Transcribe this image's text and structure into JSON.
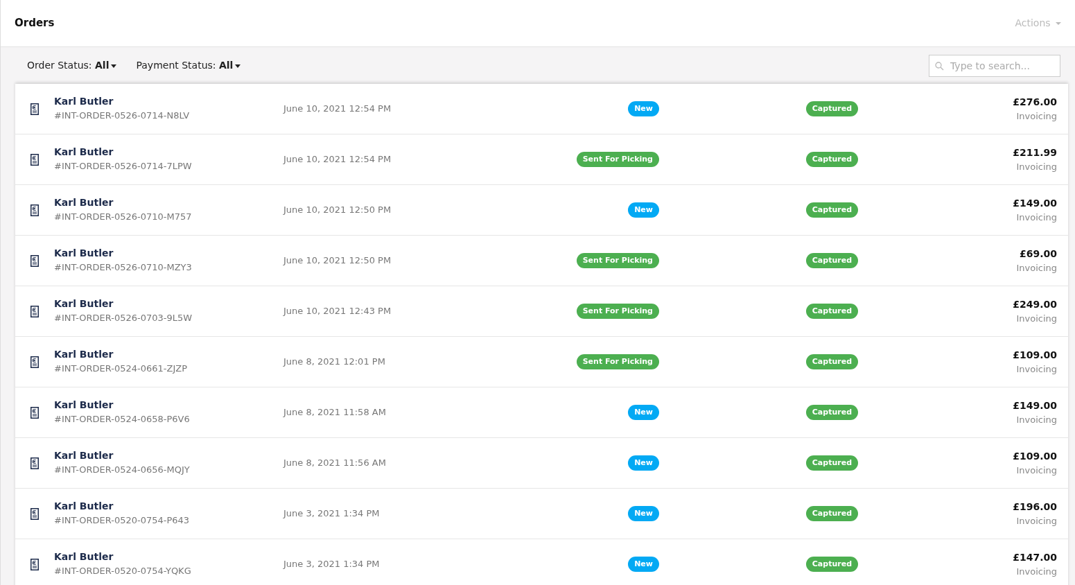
{
  "header": {
    "title": "Orders",
    "actions": "Actions"
  },
  "filters": [
    {
      "label": "Order Status:",
      "value": "All"
    },
    {
      "label": "Payment Status:",
      "value": "All"
    }
  ],
  "search": {
    "placeholder": "Type to search..."
  },
  "orders": [
    {
      "customer": "Karl Butler",
      "number": "#INT-ORDER-0526-0714-N8LV",
      "date": "June 10, 2021 12:54 PM",
      "order_status": {
        "text": "New",
        "color": "#03a9f4"
      },
      "payment_status": {
        "text": "Captured",
        "color": "#4caf50"
      },
      "amount": "£276.00",
      "stage": "Invoicing"
    },
    {
      "customer": "Karl Butler",
      "number": "#INT-ORDER-0526-0714-7LPW",
      "date": "June 10, 2021 12:54 PM",
      "order_status": {
        "text": "Sent For Picking",
        "color": "#4caf50"
      },
      "payment_status": {
        "text": "Captured",
        "color": "#4caf50"
      },
      "amount": "£211.99",
      "stage": "Invoicing"
    },
    {
      "customer": "Karl Butler",
      "number": "#INT-ORDER-0526-0710-M757",
      "date": "June 10, 2021 12:50 PM",
      "order_status": {
        "text": "New",
        "color": "#03a9f4"
      },
      "payment_status": {
        "text": "Captured",
        "color": "#4caf50"
      },
      "amount": "£149.00",
      "stage": "Invoicing"
    },
    {
      "customer": "Karl Butler",
      "number": "#INT-ORDER-0526-0710-MZY3",
      "date": "June 10, 2021 12:50 PM",
      "order_status": {
        "text": "Sent For Picking",
        "color": "#4caf50"
      },
      "payment_status": {
        "text": "Captured",
        "color": "#4caf50"
      },
      "amount": "£69.00",
      "stage": "Invoicing"
    },
    {
      "customer": "Karl Butler",
      "number": "#INT-ORDER-0526-0703-9L5W",
      "date": "June 10, 2021 12:43 PM",
      "order_status": {
        "text": "Sent For Picking",
        "color": "#4caf50"
      },
      "payment_status": {
        "text": "Captured",
        "color": "#4caf50"
      },
      "amount": "£249.00",
      "stage": "Invoicing"
    },
    {
      "customer": "Karl Butler",
      "number": "#INT-ORDER-0524-0661-ZJZP",
      "date": "June 8, 2021 12:01 PM",
      "order_status": {
        "text": "Sent For Picking",
        "color": "#4caf50"
      },
      "payment_status": {
        "text": "Captured",
        "color": "#4caf50"
      },
      "amount": "£109.00",
      "stage": "Invoicing"
    },
    {
      "customer": "Karl Butler",
      "number": "#INT-ORDER-0524-0658-P6V6",
      "date": "June 8, 2021 11:58 AM",
      "order_status": {
        "text": "New",
        "color": "#03a9f4"
      },
      "payment_status": {
        "text": "Captured",
        "color": "#4caf50"
      },
      "amount": "£149.00",
      "stage": "Invoicing"
    },
    {
      "customer": "Karl Butler",
      "number": "#INT-ORDER-0524-0656-MQJY",
      "date": "June 8, 2021 11:56 AM",
      "order_status": {
        "text": "New",
        "color": "#03a9f4"
      },
      "payment_status": {
        "text": "Captured",
        "color": "#4caf50"
      },
      "amount": "£109.00",
      "stage": "Invoicing"
    },
    {
      "customer": "Karl Butler",
      "number": "#INT-ORDER-0520-0754-P643",
      "date": "June 3, 2021 1:34 PM",
      "order_status": {
        "text": "New",
        "color": "#03a9f4"
      },
      "payment_status": {
        "text": "Captured",
        "color": "#4caf50"
      },
      "amount": "£196.00",
      "stage": "Invoicing"
    },
    {
      "customer": "Karl Butler",
      "number": "#INT-ORDER-0520-0754-YQKG",
      "date": "June 3, 2021 1:34 PM",
      "order_status": {
        "text": "New",
        "color": "#03a9f4"
      },
      "payment_status": {
        "text": "Captured",
        "color": "#4caf50"
      },
      "amount": "£147.00",
      "stage": "Invoicing"
    }
  ]
}
